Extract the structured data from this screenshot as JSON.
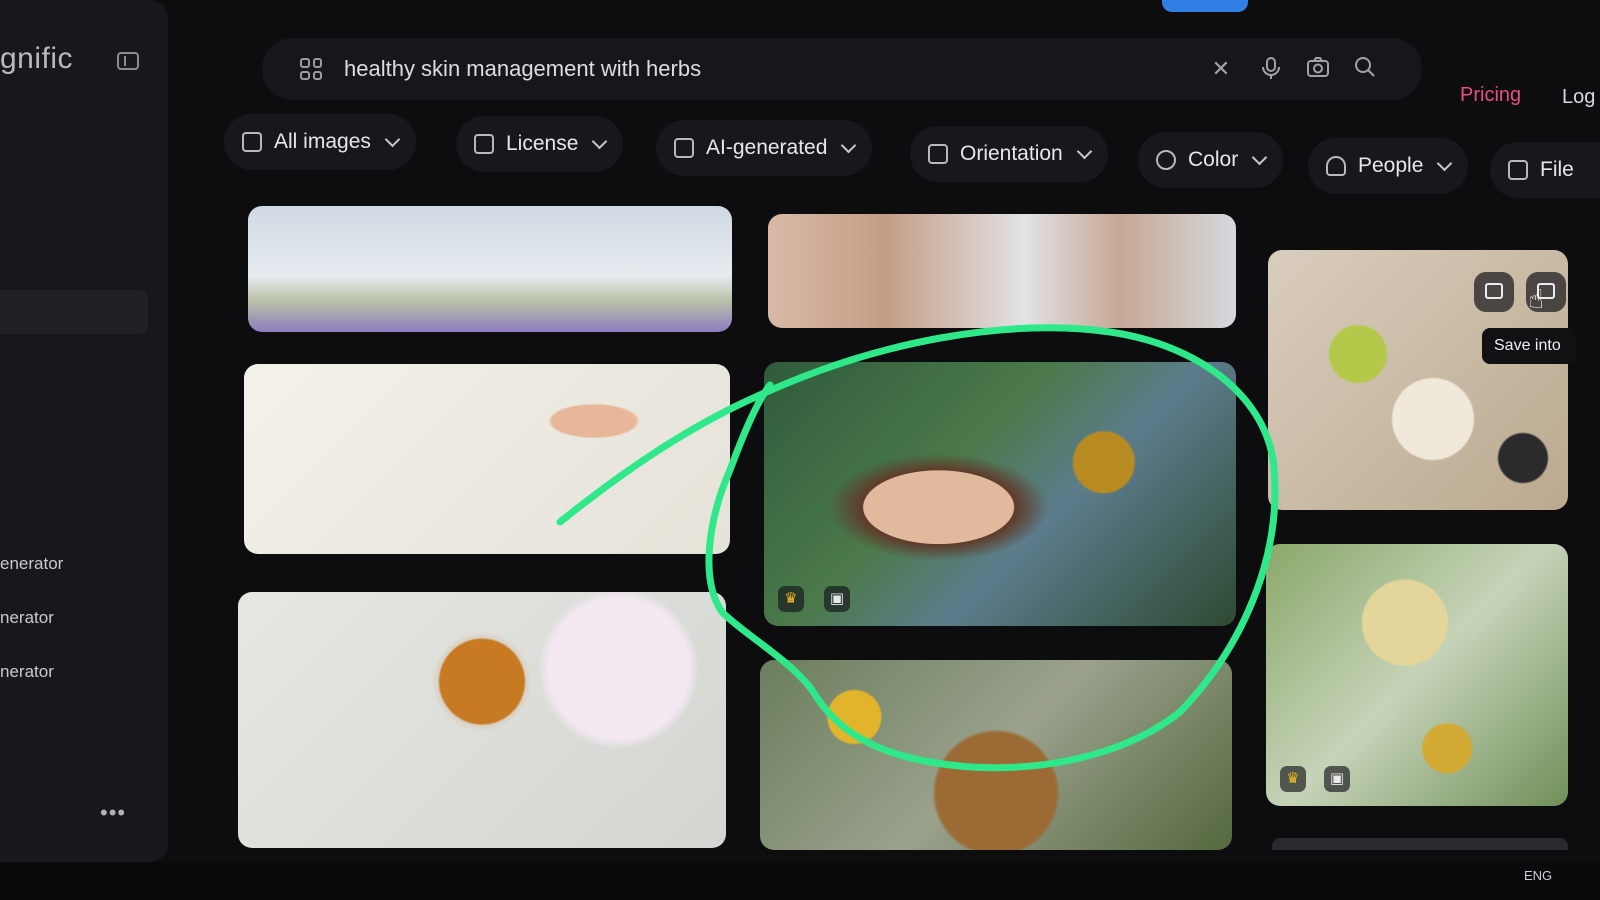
{
  "app": {
    "brand": "gnific"
  },
  "sidebar": {
    "items": [
      {
        "label": "enerator"
      },
      {
        "label": "nerator"
      },
      {
        "label": "nerator"
      }
    ],
    "more": "•••"
  },
  "search": {
    "query": "healthy skin management with herbs"
  },
  "header": {
    "pricing": "Pricing",
    "login": "Log"
  },
  "filters": [
    {
      "label": "All images",
      "icon": "grid-icon"
    },
    {
      "label": "License",
      "icon": "license-icon"
    },
    {
      "label": "AI-generated",
      "icon": "ai-icon"
    },
    {
      "label": "Orientation",
      "icon": "orientation-icon"
    },
    {
      "label": "Color",
      "icon": "palette-icon"
    },
    {
      "label": "People",
      "icon": "people-icon"
    },
    {
      "label": "File",
      "icon": "file-icon"
    }
  ],
  "tooltip": {
    "text": "Save into"
  },
  "tray": {
    "lang": "ENG"
  },
  "colors": {
    "accent_pricing": "#e5507e",
    "annotation": "#2ee88a",
    "top_accent": "#2f7fe4"
  }
}
